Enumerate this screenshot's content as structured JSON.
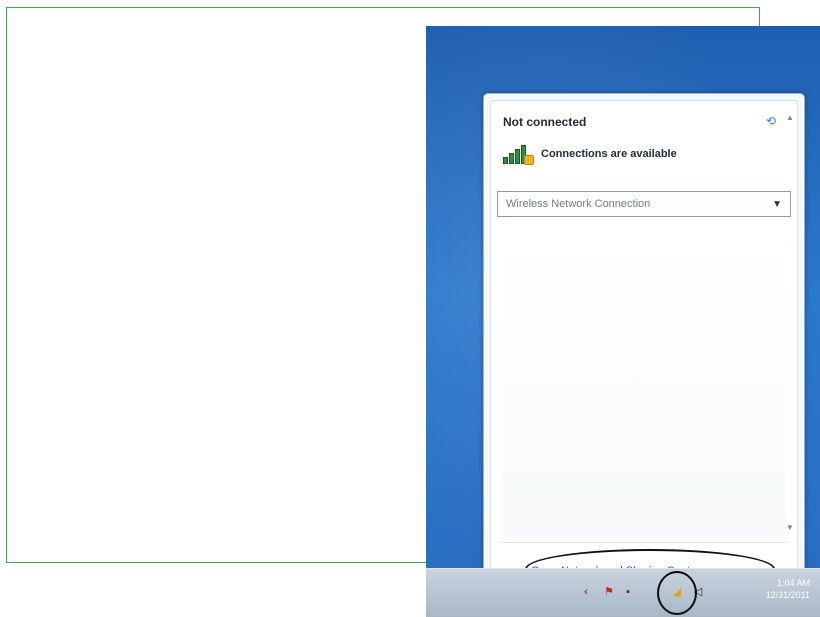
{
  "status": {
    "title": "Not connected",
    "availability": "Connections are available"
  },
  "network": {
    "selected": "Wireless Network Connection"
  },
  "footer": {
    "link": "Open Network and Sharing Center"
  },
  "taskbar": {
    "time": "1:04 AM",
    "date": "12/31/2011"
  },
  "icons": {
    "refresh": "refresh-icon",
    "signal": "signal-bars-icon",
    "dropdown": "chevron-down-icon",
    "tray_network": "wireless-network-icon",
    "tray_volume": "speaker-icon",
    "tray_flag": "action-center-flag-icon"
  },
  "colors": {
    "desktop": "#2c78cc",
    "link": "#2b63b6",
    "frame": "#3daa4a",
    "annotation": "#111111"
  }
}
